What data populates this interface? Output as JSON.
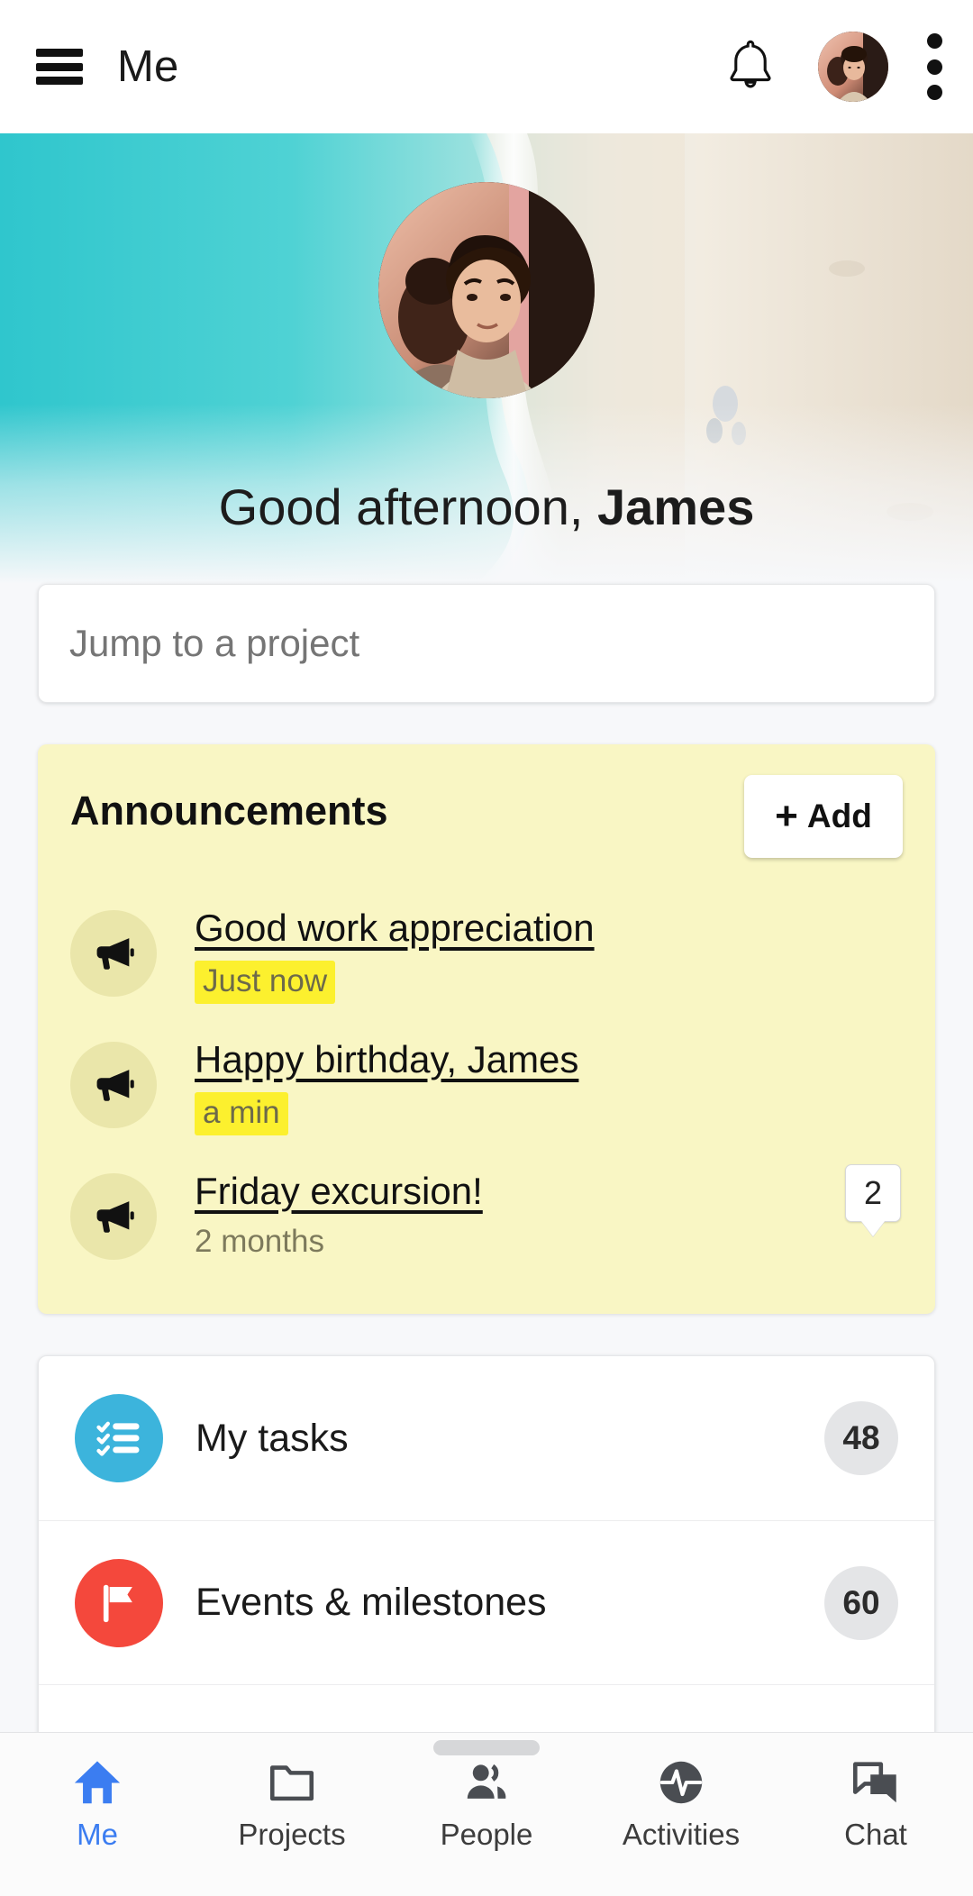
{
  "appbar": {
    "menu_icon": "hamburger-icon",
    "title": "Me",
    "bell_icon": "bell-icon",
    "avatar": "user-avatar",
    "overflow_icon": "kebab-menu-icon"
  },
  "hero": {
    "avatar": "profile-avatar",
    "greeting_prefix": "Good afternoon, ",
    "user_name": "James",
    "banner": "beach-aerial-photo"
  },
  "search": {
    "placeholder": "Jump to a project",
    "value": ""
  },
  "announcements": {
    "title": "Announcements",
    "add_label": "Add",
    "add_plus": "+",
    "items": [
      {
        "icon": "megaphone-icon",
        "title": "Good work appreciation",
        "time": "Just now",
        "highlight": true,
        "badge": ""
      },
      {
        "icon": "megaphone-icon",
        "title": "Happy birthday, James",
        "time": "a min",
        "highlight": true,
        "badge": ""
      },
      {
        "icon": "megaphone-icon",
        "title": "Friday excursion!",
        "time": "2 months",
        "highlight": false,
        "badge": "2"
      }
    ]
  },
  "quick_links": {
    "items": [
      {
        "icon": "checklist-icon",
        "label": "My tasks",
        "count": "48",
        "color": "#3cb4dc"
      },
      {
        "icon": "flag-icon",
        "label": "Events & milestones",
        "count": "60",
        "color": "#f4483c"
      }
    ]
  },
  "bottom_nav": {
    "items": [
      {
        "icon": "home-icon",
        "label": "Me",
        "active": true
      },
      {
        "icon": "folder-icon",
        "label": "Projects",
        "active": false
      },
      {
        "icon": "people-icon",
        "label": "People",
        "active": false
      },
      {
        "icon": "activity-pulse-icon",
        "label": "Activities",
        "active": false
      },
      {
        "icon": "chat-icon",
        "label": "Chat",
        "active": false
      }
    ]
  },
  "colors": {
    "accent_blue": "#3b7df1",
    "announce_bg": "#f9f6c4",
    "highlight_yellow": "#fcf02e",
    "tasks_blue": "#3cb4dc",
    "events_red": "#f4483c"
  }
}
